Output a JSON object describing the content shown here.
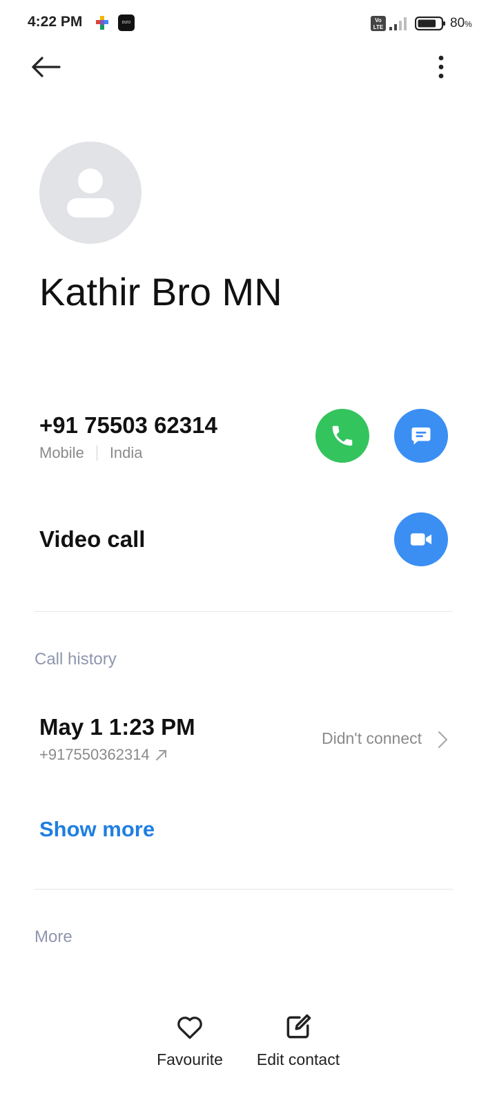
{
  "status_bar": {
    "time": "4:22 PM",
    "dizo_label": "DIZO",
    "volte_label": "Vo LTE",
    "battery_percent": "80",
    "battery_unit": "%",
    "battery_level": 0.8
  },
  "contact": {
    "name": "Kathir Bro MN",
    "phone_number": "+91 75503 62314",
    "phone_type": "Mobile",
    "phone_region": "India",
    "video_call_label": "Video call"
  },
  "call_history": {
    "section_title": "Call history",
    "entries": [
      {
        "time": "May 1 1:23 PM",
        "number": "+917550362314",
        "status": "Didn't connect"
      }
    ],
    "show_more_label": "Show more"
  },
  "more_section": {
    "title": "More"
  },
  "bottom_actions": {
    "favourite_label": "Favourite",
    "edit_label": "Edit contact"
  },
  "colors": {
    "call_green": "#34c45d",
    "action_blue": "#3b8ff3",
    "link_blue": "#1f7fe0",
    "section_gray": "#8f96ad",
    "avatar_bg": "#e1e3e6"
  }
}
